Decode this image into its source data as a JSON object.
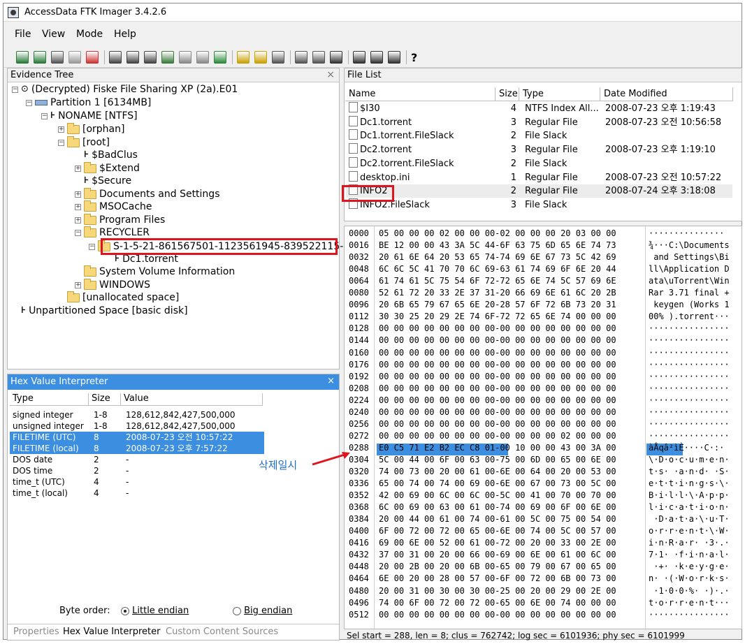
{
  "window": {
    "title": "AccessData FTK Imager 3.4.2.6"
  },
  "menu": [
    "File",
    "View",
    "Mode",
    "Help"
  ],
  "toolbar_icons": [
    "add-evidence-icon",
    "add-all-evidence-icon",
    "image-mounting-icon",
    "remove-evidence-icon",
    "remove-all-evidence-icon",
    "create-disk-image-icon",
    "export-disk-image-icon",
    "export-logical-image-icon",
    "add-to-custom-content-icon",
    "create-custom-content-image-icon",
    "decrypt-ad1-icon",
    "verify-drive-icon",
    "capture-memory-icon",
    "obtain-protected-files-icon",
    "detect-efs-icon",
    "export-files-icon",
    "export-file-hash-list-icon",
    "export-directory-listing-icon",
    "show-file-content-auto-icon",
    "show-file-content-text-icon",
    "show-file-content-hex-icon",
    "help-icon"
  ],
  "evidence_tree": {
    "title": "Evidence Tree",
    "nodes": [
      {
        "label": "(Decrypted) Fiske File Sharing XP (2a).E01",
        "level": 0
      },
      {
        "label": "Partition 1 [6134MB]",
        "level": 1
      },
      {
        "label": "NONAME [NTFS]",
        "level": 2
      },
      {
        "label": "[orphan]",
        "level": 3
      },
      {
        "label": "[root]",
        "level": 3
      },
      {
        "label": "$BadClus",
        "level": 4
      },
      {
        "label": "$Extend",
        "level": 4
      },
      {
        "label": "$Secure",
        "level": 4
      },
      {
        "label": "Documents and Settings",
        "level": 4
      },
      {
        "label": "MSOCache",
        "level": 4
      },
      {
        "label": "Program Files",
        "level": 4
      },
      {
        "label": "RECYCLER",
        "level": 4
      },
      {
        "label": "S-1-5-21-861567501-1123561945-839522115-1004",
        "level": 5
      },
      {
        "label": "Dc1.torrent",
        "level": 6
      },
      {
        "label": "System Volume Information",
        "level": 4
      },
      {
        "label": "WINDOWS",
        "level": 4
      },
      {
        "label": "[unallocated space]",
        "level": 3
      },
      {
        "label": "Unpartitioned Space [basic disk]",
        "level": 1
      }
    ]
  },
  "hex_interpreter": {
    "title": "Hex Value Interpreter",
    "columns": [
      "Type",
      "Size",
      "Value"
    ],
    "rows": [
      {
        "type": "signed integer",
        "size": "1-8",
        "value": "128,612,842,427,500,000"
      },
      {
        "type": "unsigned integer",
        "size": "1-8",
        "value": "128,612,842,427,500,000"
      },
      {
        "type": "FILETIME (UTC)",
        "size": "8",
        "value": "2008-07-23 오전 10:57:22"
      },
      {
        "type": "FILETIME (local)",
        "size": "8",
        "value": "2008-07-23 오후 7:57:22"
      },
      {
        "type": "DOS date",
        "size": "2",
        "value": "-"
      },
      {
        "type": "DOS time",
        "size": "2",
        "value": "-"
      },
      {
        "type": "time_t (UTC)",
        "size": "4",
        "value": "-"
      },
      {
        "type": "time_t (local)",
        "size": "4",
        "value": "-"
      }
    ],
    "byte_order_label": "Byte order:",
    "little_endian": "Little endian",
    "big_endian": "Big endian",
    "tabs": [
      "Properties",
      "Hex Value Interpreter",
      "Custom Content Sources"
    ]
  },
  "file_list": {
    "title": "File List",
    "columns": [
      "Name",
      "Size",
      "Type",
      "Date Modified"
    ],
    "rows": [
      {
        "name": "$I30",
        "size": "4",
        "type": "NTFS Index All...",
        "date": "2008-07-23 오후 1:19:43"
      },
      {
        "name": "Dc1.torrent",
        "size": "3",
        "type": "Regular File",
        "date": "2008-07-23 오전 10:56:58"
      },
      {
        "name": "Dc1.torrent.FileSlack",
        "size": "2",
        "type": "File Slack",
        "date": ""
      },
      {
        "name": "Dc2.torrent",
        "size": "3",
        "type": "Regular File",
        "date": "2008-07-23 오후 1:19:10"
      },
      {
        "name": "Dc2.torrent.FileSlack",
        "size": "2",
        "type": "File Slack",
        "date": ""
      },
      {
        "name": "desktop.ini",
        "size": "1",
        "type": "Regular File",
        "date": "2008-07-23 오전 10:57:22"
      },
      {
        "name": "INFO2",
        "size": "2",
        "type": "Regular File",
        "date": "2008-07-24 오후 3:18:08"
      },
      {
        "name": "INFO2.FileSlack",
        "size": "3",
        "type": "File Slack",
        "date": ""
      }
    ]
  },
  "hex_view": {
    "lines": [
      [
        "0000",
        "05 00 00 00 02 00 00 00-02 00 00 00 20 03 00 00",
        "··············· "
      ],
      [
        "0016",
        "BE 12 00 00 43 3A 5C 44-6F 63 75 6D 65 6E 74 73",
        "¾···C:\\Documents"
      ],
      [
        "0032",
        "20 61 6E 64 20 53 65 74-74 69 6E 67 73 5C 42 69",
        " and Settings\\Bi"
      ],
      [
        "0048",
        "6C 6C 5C 41 70 70 6C 69-63 61 74 69 6F 6E 20 44",
        "ll\\Application D"
      ],
      [
        "0064",
        "61 74 61 5C 75 54 6F 72-72 65 6E 74 5C 57 69 6E",
        "ata\\uTorrent\\Win"
      ],
      [
        "0080",
        "52 61 72 20 33 2E 37 31-20 66 69 6E 61 6C 20 2B",
        "Rar 3.71 final +"
      ],
      [
        "0096",
        "20 6B 65 79 67 65 6E 20-28 57 6F 72 6B 73 20 31",
        " keygen (Works 1"
      ],
      [
        "0112",
        "30 30 25 20 29 2E 74 6F-72 72 65 6E 74 00 00 00",
        "00% ).torrent···"
      ],
      [
        "0128",
        "00 00 00 00 00 00 00 00-00 00 00 00 00 00 00 00",
        "················"
      ],
      [
        "0144",
        "00 00 00 00 00 00 00 00-00 00 00 00 00 00 00 00",
        "················"
      ],
      [
        "0160",
        "00 00 00 00 00 00 00 00-00 00 00 00 00 00 00 00",
        "················"
      ],
      [
        "0176",
        "00 00 00 00 00 00 00 00-00 00 00 00 00 00 00 00",
        "················"
      ],
      [
        "0192",
        "00 00 00 00 00 00 00 00-00 00 00 00 00 00 00 00",
        "················"
      ],
      [
        "0208",
        "00 00 00 00 00 00 00 00-00 00 00 00 00 00 00 00",
        "················"
      ],
      [
        "0224",
        "00 00 00 00 00 00 00 00-00 00 00 00 00 00 00 00",
        "················"
      ],
      [
        "0240",
        "00 00 00 00 00 00 00 00-00 00 00 00 00 00 00 00",
        "················"
      ],
      [
        "0256",
        "00 00 00 00 00 00 00 00-00 00 00 00 00 00 00 00",
        "················"
      ],
      [
        "0272",
        "00 00 00 00 00 00 00 00-00 00 00 00 02 00 00 00",
        "················"
      ],
      [
        "0288",
        "E0 C5 71 E2 B2 EC C8 01-00 10 00 00 43 00 3A 00",
        "àÅqâ²ìÈ····C·:·"
      ],
      [
        "0304",
        "5C 00 44 00 6F 00 63 00-75 00 6D 00 65 00 6E 00",
        "\\·D·o·c·u·m·e·n·"
      ],
      [
        "0320",
        "74 00 73 00 20 00 61 00-6E 00 64 00 20 00 53 00",
        "t·s· ·a·n·d· ·S·"
      ],
      [
        "0336",
        "65 00 74 00 74 00 69 00-6E 00 67 00 73 00 5C 00",
        "e·t·t·i·n·g·s·\\·"
      ],
      [
        "0352",
        "42 00 69 00 6C 00 6C 00-5C 00 41 00 70 00 70 00",
        "B·i·l·l·\\·A·p·p·"
      ],
      [
        "0368",
        "6C 00 69 00 63 00 61 00-74 00 69 00 6F 00 6E 00",
        "l·i·c·a·t·i·o·n·"
      ],
      [
        "0384",
        "20 00 44 00 61 00 74 00-61 00 5C 00 75 00 54 00",
        " ·D·a·t·a·\\·u·T·"
      ],
      [
        "0400",
        "6F 00 72 00 72 00 65 00-6E 00 74 00 5C 00 57 00",
        "o·r·r·e·n·t·\\·W·"
      ],
      [
        "0416",
        "69 00 6E 00 52 00 61 00-72 00 20 00 33 00 2E 00",
        "i·n·R·a·r· ·3·.·"
      ],
      [
        "0432",
        "37 00 31 00 20 00 66 00-69 00 6E 00 61 00 6C 00",
        "7·1· ·f·i·n·a·l·"
      ],
      [
        "0448",
        "20 00 2B 00 20 00 6B 00-65 00 79 00 67 00 65 00",
        " ·+· ·k·e·y·g·e·"
      ],
      [
        "0464",
        "6E 00 20 00 28 00 57 00-6F 00 72 00 6B 00 73 00",
        "n· ·(·W·o·r·k·s·"
      ],
      [
        "0480",
        "20 00 31 00 30 00 30 00-25 00 20 00 29 00 2E 00",
        " ·1·0·0·%· ·)·.·"
      ],
      [
        "0496",
        "74 00 6F 00 72 00 72 00-65 00 6E 00 74 00 00 00",
        "t·o·r·r·e·n·t···"
      ],
      [
        "0512",
        "00 00 00 00 00 00 00 00-00 00 00 00 00 00 00 00",
        "················"
      ]
    ]
  },
  "status_bar": "Sel start = 288, len = 8; clus = 762742; log sec = 6101936; phy sec = 6101999",
  "annotation": "삭제일시",
  "colors": {
    "selection": "#3c8fe0",
    "highlight_box": "#e0141e",
    "annotation": "#1e6fc8"
  }
}
